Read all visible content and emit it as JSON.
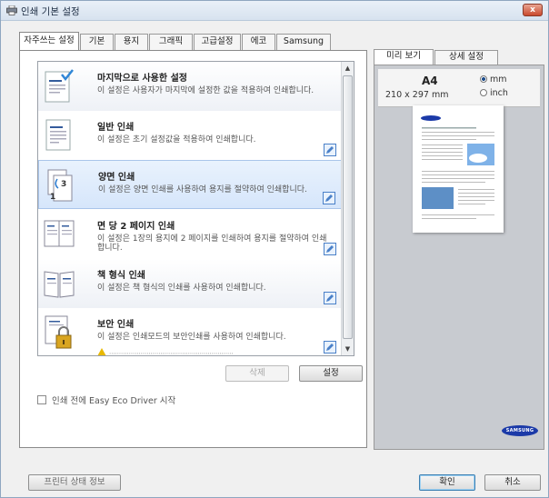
{
  "window": {
    "title": "인쇄 기본 설정",
    "close_label": "x"
  },
  "tabs": [
    {
      "label": "자주쓰는 설정"
    },
    {
      "label": "기본"
    },
    {
      "label": "용지"
    },
    {
      "label": "그래픽"
    },
    {
      "label": "고급설정"
    },
    {
      "label": "에코"
    },
    {
      "label": "Samsung"
    }
  ],
  "favorites": [
    {
      "title": "마지막으로 사용한 설정",
      "desc": "이 설정은 사용자가 마지막에 설정한 값을 적용하여 인쇄합니다.",
      "icon": "last-used-settings-icon"
    },
    {
      "title": "일반 인쇄",
      "desc": "이 설정은 초기 설정값을 적용하여 인쇄합니다.",
      "icon": "normal-print-icon"
    },
    {
      "title": "양면 인쇄",
      "desc": "이 설정은 양면 인쇄를 사용하여 용지를 절약하여 인쇄합니다.",
      "icon": "duplex-print-icon"
    },
    {
      "title": "면 당 2 페이지 인쇄",
      "desc": "이 설정은 1장의 용지에 2 페이지를 인쇄하여 용지를 절약하여 인쇄합니다.",
      "icon": "two-pages-per-side-icon"
    },
    {
      "title": "책 형식 인쇄",
      "desc": "이 설정은 책 형식의 인쇄를 사용하여 인쇄합니다.",
      "icon": "booklet-print-icon"
    },
    {
      "title": "보안 인쇄",
      "desc": "이 설정은 인쇄모드의 보안인쇄를 사용하여 인쇄합니다.",
      "icon": "secure-print-icon"
    }
  ],
  "buttons": {
    "delete": "삭제",
    "settings": "설정",
    "printer_status": "프린터 상태 정보",
    "ok": "확인",
    "cancel": "취소"
  },
  "eco_option": {
    "label": "인쇄 전에 Easy Eco Driver 시작",
    "checked": false
  },
  "preview": {
    "tabs": [
      {
        "label": "미리 보기"
      },
      {
        "label": "상세 설정"
      }
    ],
    "paper_name": "A4",
    "paper_dims": "210 x 297 mm",
    "units": [
      {
        "label": "mm",
        "selected": true
      },
      {
        "label": "inch",
        "selected": false
      }
    ],
    "brand": "SAMSUNG"
  },
  "colors": {
    "accent": "#1f4e8c",
    "brand_blue": "#1b3aa8",
    "selected_row": "#d6e6fb"
  }
}
